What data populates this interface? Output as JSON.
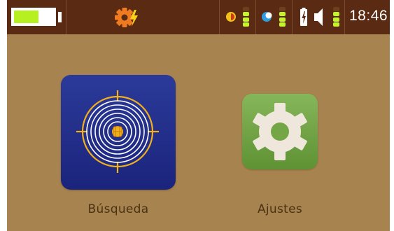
{
  "status_bar": {
    "battery": {
      "level": 0.62,
      "fill_color": "#b7f020",
      "icon": "battery-icon"
    },
    "alert_icon": "gear-warning-icon",
    "indicator_1": {
      "icon": "half-circle-icon",
      "colors": [
        "#f2c21a",
        "#cc3a18"
      ],
      "bars_on": 3,
      "bars_total": 4
    },
    "indicator_2": {
      "icon": "moon-icon",
      "colors": [
        "#2f9de0",
        "#ffffff"
      ],
      "bars_on": 3,
      "bars_total": 4
    },
    "indicator_3": {
      "icon": "battery-charging-icon",
      "speaker_icon": "speaker-icon",
      "bars_on": 3,
      "bars_total": 4
    },
    "time": "18:46"
  },
  "apps": [
    {
      "label": "Búsqueda",
      "icon": "target-search-icon",
      "tile_color": "#22308a"
    },
    {
      "label": "Ajustes",
      "icon": "gear-icon",
      "tile_color": "#6fa444"
    }
  ],
  "colors": {
    "background": "#a7834f",
    "status_bar": "#5a2a13",
    "accent_green": "#c3f52a",
    "accent_orange": "#f07a20"
  }
}
